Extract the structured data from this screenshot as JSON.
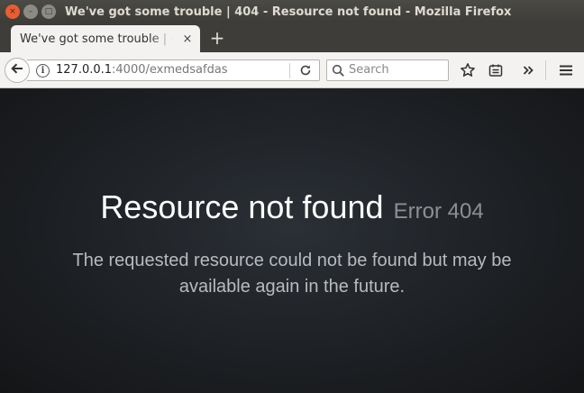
{
  "window": {
    "title": "We've got some trouble | 404 - Resource not found - Mozilla Firefox",
    "buttons": {
      "close": "×",
      "minimize": "–",
      "maximize": "□"
    }
  },
  "tabs": [
    {
      "title": "We've got some trouble | 404 - Resource not found",
      "close": "×",
      "active": true
    }
  ],
  "new_tab_label": "+",
  "navbar": {
    "url_host": "127.0.0.1",
    "url_rest": ":4000/exmedsafdas",
    "search_placeholder": "Search"
  },
  "icons": {
    "back": "back-arrow-icon",
    "info": "info-icon",
    "reload": "reload-icon",
    "search": "search-icon",
    "bookmark": "star-icon",
    "reading_list": "reading-list-icon",
    "overflow": "chevron-right-double-icon",
    "menu": "hamburger-menu-icon"
  },
  "page": {
    "heading": "Resource not found",
    "error_code": "Error 404",
    "message": "The requested resource could not be found but may be available again in the future."
  },
  "colors": {
    "titlebar": "#3d3c38",
    "close_button": "#e95d33",
    "chrome": "#f3f2f1",
    "content_bg": "#1d2024",
    "heading": "#ffffff",
    "error_code": "#8d8f92",
    "message": "#b8bbbe"
  }
}
